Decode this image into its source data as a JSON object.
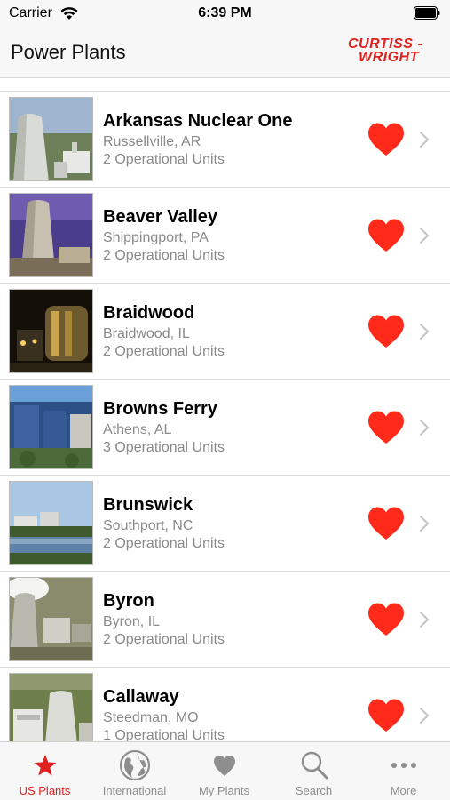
{
  "status_bar": {
    "carrier": "Carrier",
    "time": "6:39 PM"
  },
  "nav": {
    "title": "Power Plants",
    "logo_line1": "CURTISS -",
    "logo_line2": "WRIGHT"
  },
  "colors": {
    "accent": "#e0211f",
    "heart": "#ff2a1a",
    "secondary_text": "#8a8a8a"
  },
  "plants": [
    {
      "name": "Arkansas Nuclear One",
      "location": "Russellville, AR",
      "units": "2 Operational Units",
      "favorite": true
    },
    {
      "name": "Beaver Valley",
      "location": "Shippingport, PA",
      "units": "2 Operational Units",
      "favorite": true
    },
    {
      "name": "Braidwood",
      "location": "Braidwood, IL",
      "units": "2 Operational Units",
      "favorite": true
    },
    {
      "name": "Browns Ferry",
      "location": "Athens, AL",
      "units": "3 Operational Units",
      "favorite": true
    },
    {
      "name": "Brunswick",
      "location": "Southport, NC",
      "units": "2 Operational Units",
      "favorite": true
    },
    {
      "name": "Byron",
      "location": "Byron, IL",
      "units": "2 Operational Units",
      "favorite": true
    },
    {
      "name": "Callaway",
      "location": "Steedman, MO",
      "units": "1 Operational Units",
      "favorite": true
    }
  ],
  "tabs": [
    {
      "label": "US Plants",
      "icon": "star-icon",
      "active": true
    },
    {
      "label": "International",
      "icon": "globe-icon",
      "active": false
    },
    {
      "label": "My Plants",
      "icon": "heart-icon",
      "active": false
    },
    {
      "label": "Search",
      "icon": "search-icon",
      "active": false
    },
    {
      "label": "More",
      "icon": "more-icon",
      "active": false
    }
  ]
}
